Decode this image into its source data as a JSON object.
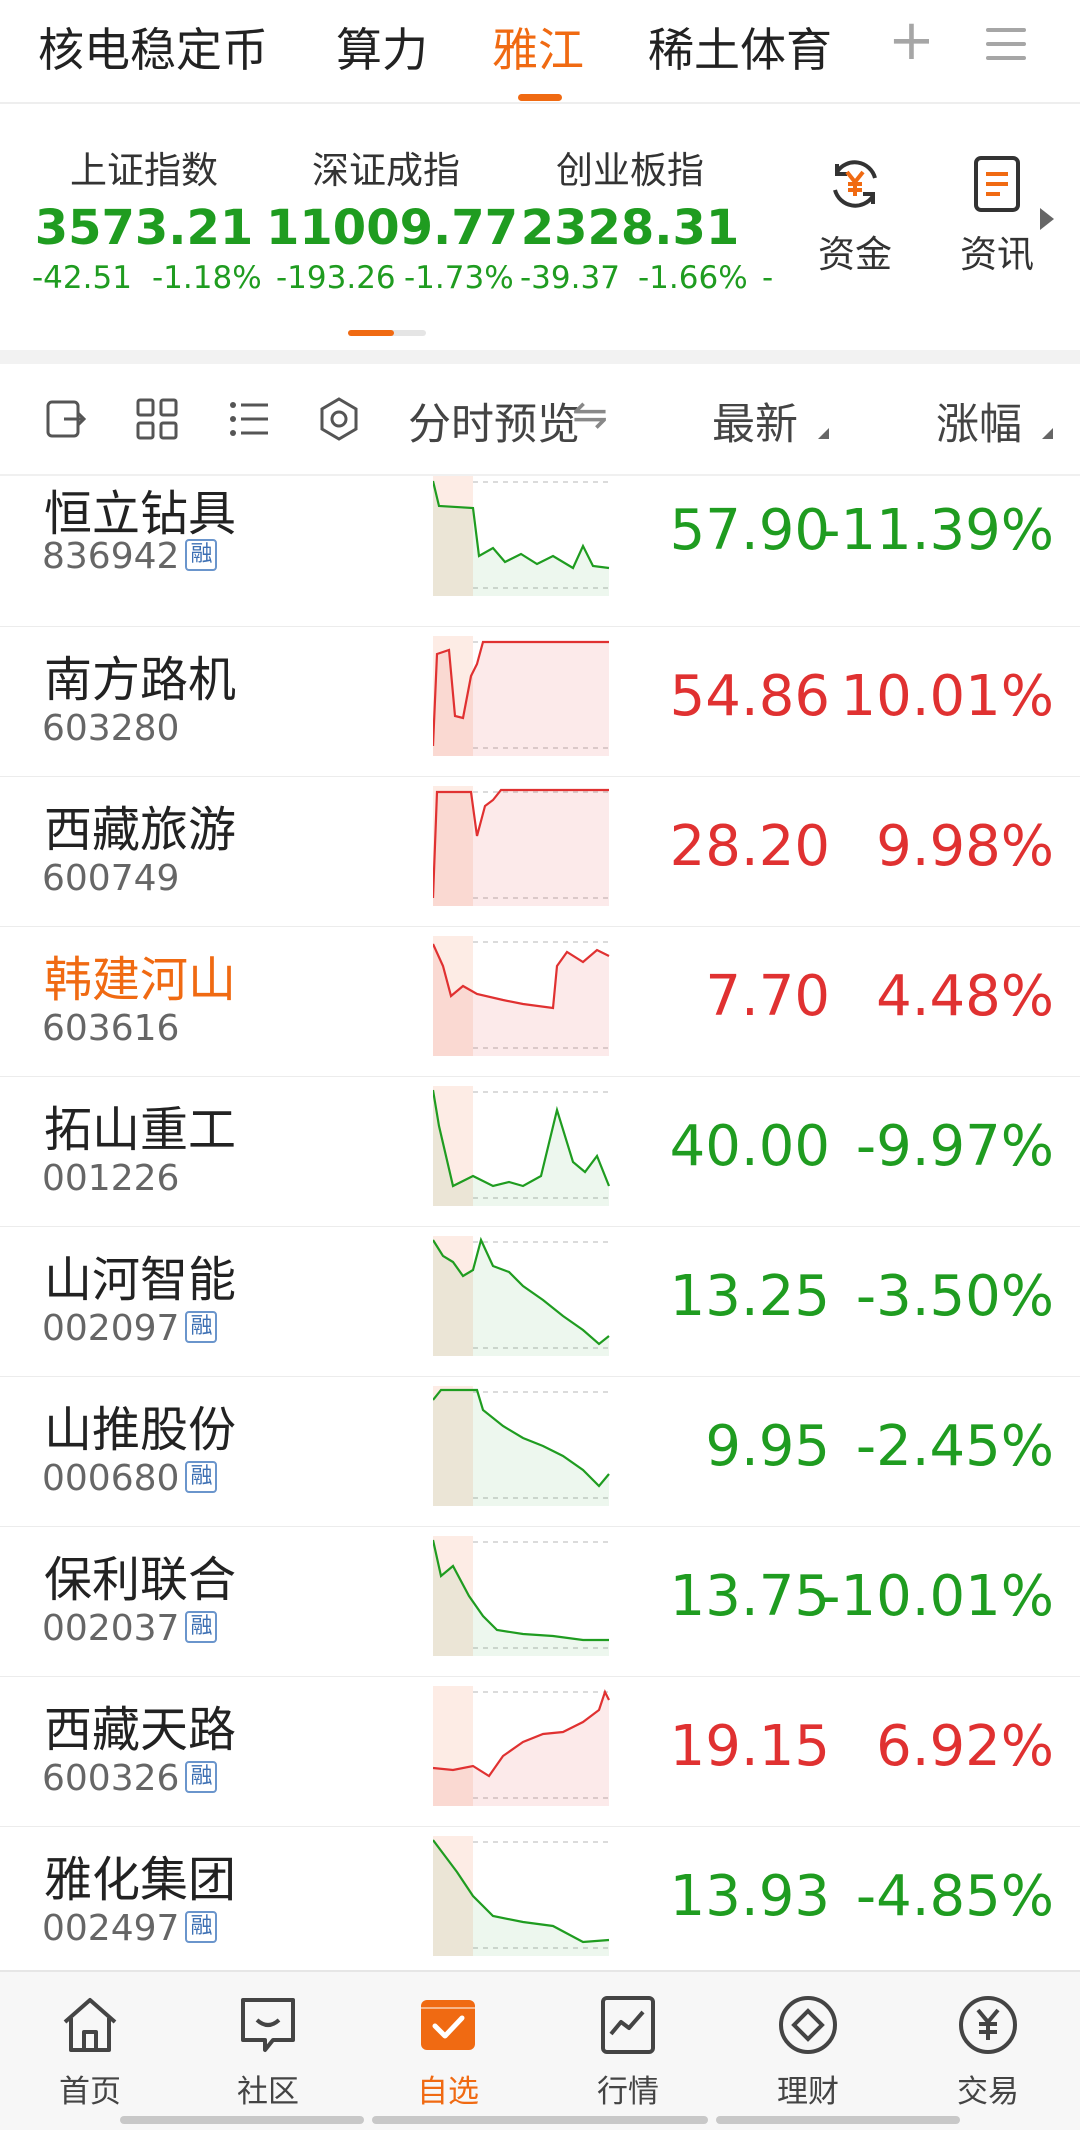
{
  "tabs": [
    {
      "label": "核电稳定币",
      "active": false
    },
    {
      "label": "算力",
      "active": false
    },
    {
      "label": "雅江",
      "active": true
    },
    {
      "label": "稀土体育",
      "active": false
    }
  ],
  "tab_actions": {
    "add_icon": "plus-icon",
    "menu_icon": "hamburger-menu-icon"
  },
  "indices": [
    {
      "name": "上证指数",
      "value": "3573.21",
      "change": "-42.51",
      "pct": "-1.18%"
    },
    {
      "name": "深证成指",
      "value": "11009.77",
      "change": "-193.26",
      "pct": "-1.73%"
    },
    {
      "name": "创业板指",
      "value": "2328.31",
      "change": "-39.37",
      "pct": "-1.66%"
    }
  ],
  "index_overflow_text": "-",
  "shortcuts": [
    {
      "label": "资金",
      "icon": "yuan-refresh-icon"
    },
    {
      "label": "资讯",
      "icon": "news-document-icon"
    }
  ],
  "list_header": {
    "icons": [
      "share-export-icon",
      "grid-view-icon",
      "list-view-icon",
      "settings-hexagon-icon"
    ],
    "preview_label": "分时预览",
    "preview_toggle": "⇋",
    "latest_label": "最新",
    "change_label": "涨幅"
  },
  "colors": {
    "accent": "#f06a12",
    "up": "#e03131",
    "down": "#1f9c20",
    "margin_tag": "#3c6fb3"
  },
  "stocks": [
    {
      "name": "恒立钻具",
      "code": "836942",
      "margin": true,
      "price": "57.90",
      "pct": "-11.39%",
      "dir": "down",
      "highlight": false
    },
    {
      "name": "南方路机",
      "code": "603280",
      "margin": false,
      "price": "54.86",
      "pct": "10.01%",
      "dir": "up",
      "highlight": false
    },
    {
      "name": "西藏旅游",
      "code": "600749",
      "margin": false,
      "price": "28.20",
      "pct": "9.98%",
      "dir": "up",
      "highlight": false
    },
    {
      "name": "韩建河山",
      "code": "603616",
      "margin": false,
      "price": "7.70",
      "pct": "4.48%",
      "dir": "up",
      "highlight": true
    },
    {
      "name": "拓山重工",
      "code": "001226",
      "margin": false,
      "price": "40.00",
      "pct": "-9.97%",
      "dir": "down",
      "highlight": false
    },
    {
      "name": "山河智能",
      "code": "002097",
      "margin": true,
      "price": "13.25",
      "pct": "-3.50%",
      "dir": "down",
      "highlight": false
    },
    {
      "name": "山推股份",
      "code": "000680",
      "margin": true,
      "price": "9.95",
      "pct": "-2.45%",
      "dir": "down",
      "highlight": false
    },
    {
      "name": "保利联合",
      "code": "002037",
      "margin": true,
      "price": "13.75",
      "pct": "-10.01%",
      "dir": "down",
      "highlight": false
    },
    {
      "name": "西藏天路",
      "code": "600326",
      "margin": true,
      "price": "19.15",
      "pct": "6.92%",
      "dir": "up",
      "highlight": false
    },
    {
      "name": "雅化集团",
      "code": "002497",
      "margin": true,
      "price": "13.93",
      "pct": "-4.85%",
      "dir": "down",
      "highlight": false
    }
  ],
  "margin_tag_label": "融",
  "bottom_nav": [
    {
      "label": "首页",
      "icon": "home-icon",
      "active": false
    },
    {
      "label": "社区",
      "icon": "community-chat-icon",
      "active": false
    },
    {
      "label": "自选",
      "icon": "watchlist-check-icon",
      "active": true
    },
    {
      "label": "行情",
      "icon": "market-chart-icon",
      "active": false
    },
    {
      "label": "理财",
      "icon": "wealth-diamond-icon",
      "active": false
    },
    {
      "label": "交易",
      "icon": "trade-yuan-icon",
      "active": false
    }
  ]
}
